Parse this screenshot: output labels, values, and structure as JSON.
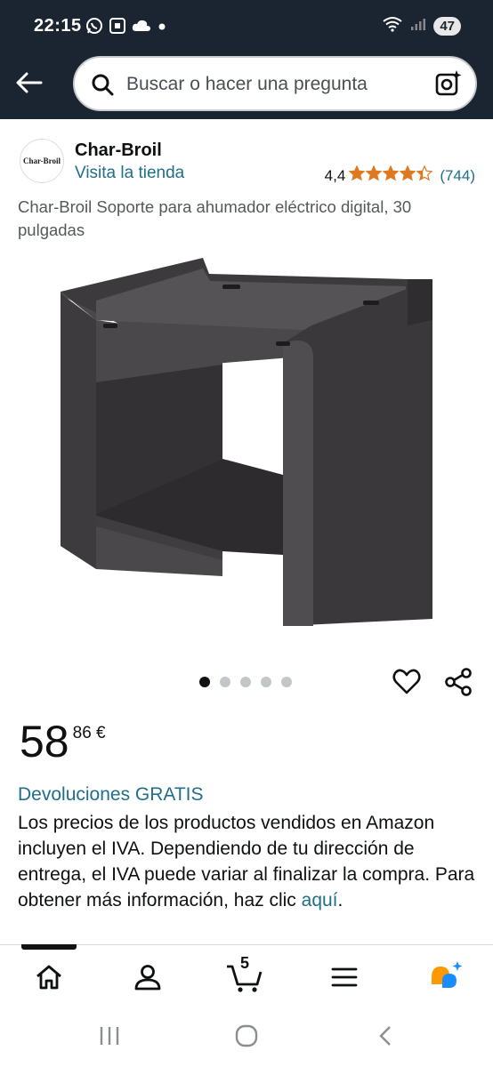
{
  "status_bar": {
    "time": "22:15",
    "battery": "47",
    "left_icons": [
      "whatsapp-icon",
      "screenshot-icon",
      "cloud-icon",
      "dot-icon"
    ],
    "right_icons": [
      "wifi-icon",
      "signal-icon",
      "battery-icon"
    ]
  },
  "header": {
    "search_placeholder": "Buscar o hacer una pregunta",
    "icons": [
      "back-arrow-icon",
      "search-icon",
      "camera-lens-icon"
    ]
  },
  "brand": {
    "logo_text": "Char-Broil",
    "name": "Char-Broil",
    "store_link": "Visita la tienda"
  },
  "rating": {
    "value": "4,4",
    "stars": 4.4,
    "count": "(744)",
    "star_color": "#de7921"
  },
  "product": {
    "title": "Char-Broil Soporte para ahumador eléctrico digital, 30 pulgadas",
    "image_count": 5,
    "active_image": 0
  },
  "price": {
    "whole": "58",
    "fraction": "86 €"
  },
  "info": {
    "returns": "Devoluciones GRATIS",
    "vat_text": "Los precios de los productos vendidos en Amazon incluyen el IVA. Dependiendo de tu dirección de entrega, el IVA puede variar al finalizar la compra. Para obtener más información, haz clic ",
    "vat_link": "aquí",
    "vat_end": "."
  },
  "bottom_nav": {
    "cart_count": "5",
    "items": [
      "home-icon",
      "account-icon",
      "cart-icon",
      "menu-icon",
      "rufus-ai-icon"
    ]
  },
  "colors": {
    "header_bg": "#1b2431",
    "link": "#1f6f8b",
    "accent_orange": "#ff9900",
    "accent_blue": "#1a8cff"
  }
}
